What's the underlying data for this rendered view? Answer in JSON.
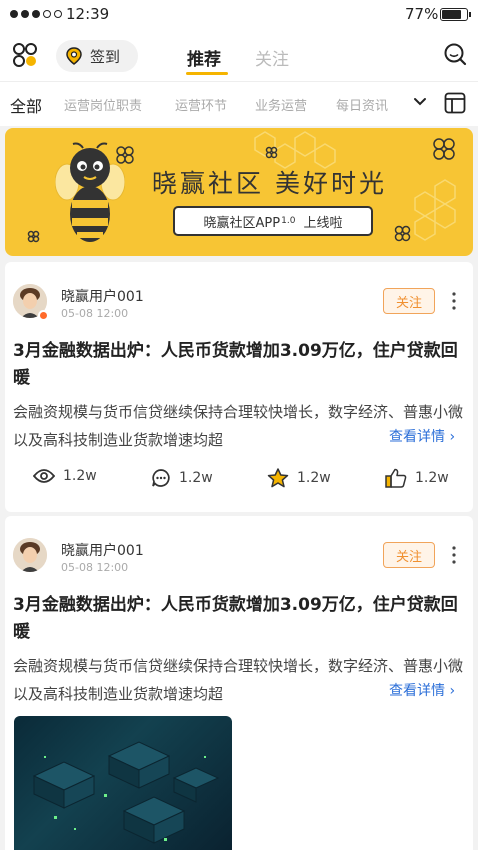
{
  "status_bar": {
    "time": "12:39",
    "battery": "77%"
  },
  "header": {
    "checkin_label": "签到",
    "tabs": [
      {
        "label": "推荐",
        "active": true
      },
      {
        "label": "关注",
        "active": false
      }
    ]
  },
  "categories": [
    "全部",
    "运营岗位职责",
    "运营环节",
    "业务运营",
    "每日资讯"
  ],
  "banner": {
    "slogan": "晓赢社区  美好时光",
    "pill_main": "晓赢社区APP",
    "pill_version": "1.0",
    "pill_tail": "上线啦"
  },
  "posts": [
    {
      "user": "晓赢用户001",
      "date": "05-08 12:00",
      "follow_label": "关注",
      "title": "3月金融数据出炉：人民币货款增加3.09万亿，住户贷款回暖",
      "summary": "会融资规模与货币信贷继续保持合理较快增长，数字经济、普惠小微以及高科技制造业货款增速均超",
      "detail_link": "查看详情",
      "views": "1.2w",
      "comments": "1.2w",
      "favorites": "1.2w",
      "likes": "1.2w"
    },
    {
      "user": "晓赢用户001",
      "date": "05-08 12:00",
      "follow_label": "关注",
      "title": "3月金融数据出炉：人民币货款增加3.09万亿，住户贷款回暖",
      "summary": "会融资规模与货币信贷继续保持合理较快增长，数字经济、普惠小微以及高科技制造业货款增速均超",
      "detail_link": "查看详情"
    }
  ],
  "colors": {
    "accent": "#f5b400",
    "banner": "#f7c534",
    "link": "#2c6fd8",
    "follow": "#f09030"
  }
}
